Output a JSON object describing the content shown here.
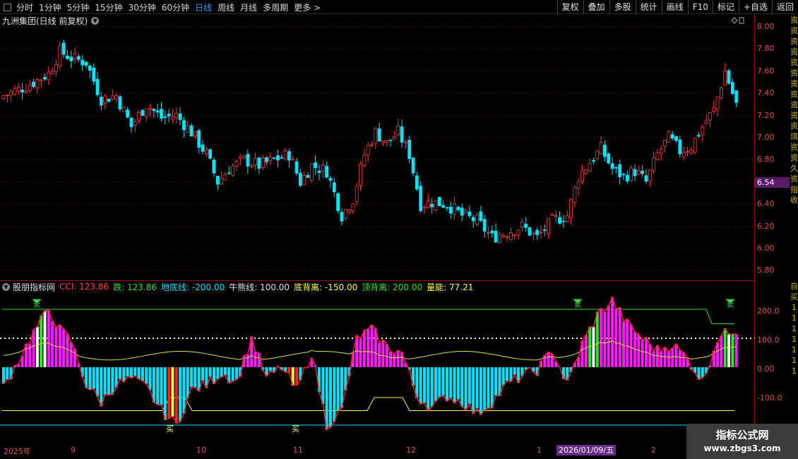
{
  "toolbar": {
    "periods": [
      "分时",
      "1分钟",
      "5分钟",
      "15分钟",
      "30分钟",
      "60分钟",
      "日线",
      "周线",
      "月线",
      "多周期",
      "更多 >"
    ],
    "active": "日线",
    "right_buttons": [
      "复权",
      "叠加",
      "多股",
      "统计",
      "画线",
      "F10",
      "标记",
      "+自选",
      "返回"
    ]
  },
  "chart_title": "九洲集团(日线 前复权)",
  "price_axis": [
    "8.00",
    "7.80",
    "7.60",
    "7.40",
    "7.20",
    "7.00",
    "6.80",
    "6.60",
    "6.40",
    "6.20",
    "6.00",
    "5.80"
  ],
  "current_price": "6.54",
  "indicator": {
    "name": "股朋指标网",
    "cci": "CCI: 123.86",
    "die": "跌: 123.86",
    "didi": "地底线: -200.00",
    "niuxiong": "牛熊线: 100.00",
    "dibeili": "底背离: -150.00",
    "dingbeili": "顶背离: 200.00",
    "liangneng": "量能: 77.21",
    "axis": [
      "200.0",
      "100.0",
      "0.00",
      "-100.0"
    ],
    "buy_label": "买",
    "sell_label": "卖"
  },
  "date_axis": {
    "labels": [
      "2025年",
      "9",
      "10",
      "11",
      "12",
      "1",
      "2"
    ],
    "highlight": "2026/01/09/五"
  },
  "right_strip_top": [
    "资",
    "资",
    "资",
    "资",
    "资",
    "资",
    "资",
    "资",
    "资",
    "资",
    "资",
    "琪",
    "资",
    "资",
    "久",
    "资",
    "指",
    "收"
  ],
  "right_strip_bottom": [
    "自",
    "买",
    "1",
    "1",
    "1",
    "1",
    "1",
    "1",
    "1"
  ],
  "watermark": {
    "line1": "指标公式网",
    "line2": "www.zbgs3.com"
  },
  "colors": {
    "up": "#ff3a3a",
    "down": "#00e5ff",
    "magenta": "#ff1aff",
    "yellow": "#ffff33",
    "green": "#33dd33"
  }
}
